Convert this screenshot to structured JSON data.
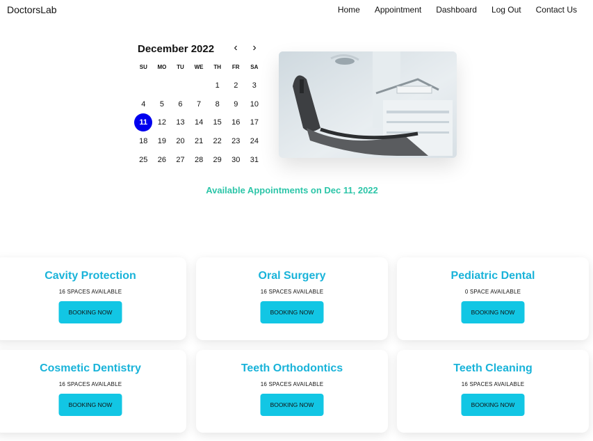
{
  "navbar": {
    "brand": "DoctorsLab",
    "links": [
      "Home",
      "Appointment",
      "Dashboard",
      "Log Out",
      "Contact Us"
    ]
  },
  "calendar": {
    "month_label": "December 2022",
    "prev_symbol": "‹",
    "next_symbol": "›",
    "weekdays": [
      "SU",
      "MO",
      "TU",
      "WE",
      "TH",
      "FR",
      "SA"
    ],
    "days": [
      "",
      "",
      "",
      "",
      "1",
      "2",
      "3",
      "4",
      "5",
      "6",
      "7",
      "8",
      "9",
      "10",
      "11",
      "12",
      "13",
      "14",
      "15",
      "16",
      "17",
      "18",
      "19",
      "20",
      "21",
      "22",
      "23",
      "24",
      "25",
      "26",
      "27",
      "28",
      "29",
      "30",
      "31"
    ],
    "selected_day": "11"
  },
  "availability_heading": "Available Appointments on Dec 11, 2022",
  "services": [
    {
      "title": "Cavity Protection",
      "spaces": "16 SPACES AVAILABLE",
      "button": "BOOKING NOW"
    },
    {
      "title": "Oral Surgery",
      "spaces": "16 SPACES AVAILABLE",
      "button": "BOOKING NOW"
    },
    {
      "title": "Pediatric Dental",
      "spaces": "0 SPACE AVAILABLE",
      "button": "BOOKING NOW"
    },
    {
      "title": "Cosmetic Dentistry",
      "spaces": "16 SPACES AVAILABLE",
      "button": "BOOKING NOW"
    },
    {
      "title": "Teeth Orthodontics",
      "spaces": "16 SPACES AVAILABLE",
      "button": "BOOKING NOW"
    },
    {
      "title": "Teeth Cleaning",
      "spaces": "16 SPACES AVAILABLE",
      "button": "BOOKING NOW"
    }
  ],
  "colors": {
    "accent_green": "#2cc5a8",
    "card_title": "#19b3d9",
    "button_bg": "#12c6e4",
    "selected_day": "#0000ee"
  }
}
